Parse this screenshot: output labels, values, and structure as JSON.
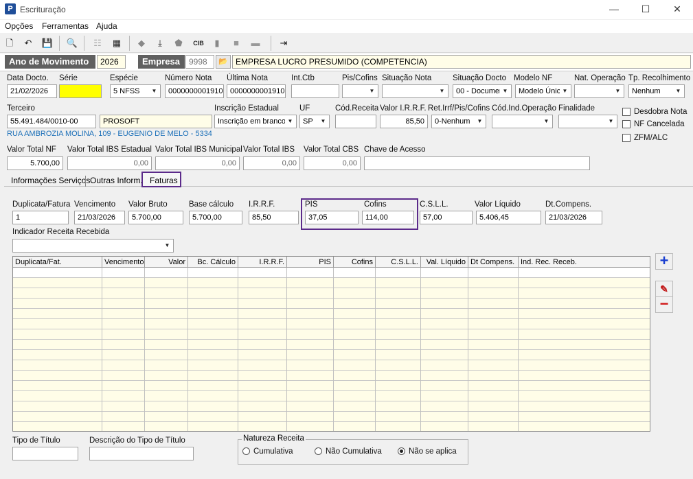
{
  "window": {
    "title": "Escrituração",
    "icon_letter": "P",
    "minimize": "—",
    "maximize": "☐",
    "close": "✕"
  },
  "menu": [
    "Opções",
    "Ferramentas",
    "Ajuda"
  ],
  "header": {
    "ano_label": "Ano de Movimento",
    "ano_value": "2026",
    "empresa_label": "Empresa",
    "empresa_code": "9998",
    "empresa_name": "EMPRESA LUCRO PRESUMIDO (COMPETENCIA)"
  },
  "row1": {
    "data_docto": {
      "label": "Data Docto.",
      "value": "21/02/2026"
    },
    "serie": {
      "label": "Série",
      "value": ""
    },
    "especie": {
      "label": "Espécie",
      "value": "5 NFSS"
    },
    "numero_nota": {
      "label": "Número Nota",
      "value": "0000000001910"
    },
    "ultima_nota": {
      "label": "Última Nota",
      "value": "0000000001910"
    },
    "int_ctb": {
      "label": "Int.Ctb",
      "value": ""
    },
    "pis_cofins": {
      "label": "Pis/Cofins",
      "value": ""
    },
    "situacao_nota": {
      "label": "Situação Nota",
      "value": ""
    },
    "situacao_docto": {
      "label": "Situação Docto",
      "value": "00 - Documer"
    },
    "modelo_nf": {
      "label": "Modelo NF",
      "value": "Modelo Únic"
    },
    "nat_operacao": {
      "label": "Nat. Operação",
      "value": ""
    },
    "tp_recolhimento": {
      "label": "Tp. Recolhimento",
      "value": "Nenhum"
    }
  },
  "row2": {
    "terceiro": {
      "label": "Terceiro",
      "cnpj": "55.491.484/0010-00",
      "name": "PROSOFT"
    },
    "inscricao_estadual": {
      "label": "Inscrição Estadual",
      "value": "Inscrição em branco"
    },
    "uf": {
      "label": "UF",
      "value": "SP"
    },
    "cod_receita": {
      "label": "Cód.Receita",
      "value": ""
    },
    "valor_irrf": {
      "label": "Valor I.R.R.F.",
      "value": "85,50"
    },
    "ret_irrf": {
      "label": "Ret.Irrf/Pis/Cofins",
      "value": "0-Nenhum"
    },
    "cod_ind_operacao": {
      "label": "Cód.Ind.Operação",
      "value": ""
    },
    "finalidade": {
      "label": "Finalidade",
      "value": ""
    },
    "address": "RUA AMBROZIA MOLINA, 109 - EUGENIO DE MELO - 5334"
  },
  "checkboxes": [
    "Desdobra Nota",
    "NF Cancelada",
    "ZFM/ALC"
  ],
  "row3": {
    "valor_total_nf": {
      "label": "Valor Total NF",
      "value": "5.700,00"
    },
    "valor_total_ibs_estadual": {
      "label": "Valor Total IBS Estadual",
      "value": "0,00"
    },
    "valor_total_ibs_municipal": {
      "label": "Valor Total IBS Municipal",
      "value": "0,00"
    },
    "valor_total_ibs": {
      "label": "Valor Total IBS",
      "value": "0,00"
    },
    "valor_total_cbs": {
      "label": "Valor Total CBS",
      "value": "0,00"
    },
    "chave_acesso": {
      "label": "Chave de Acesso",
      "value": ""
    }
  },
  "tabs": [
    "Informações Serviços",
    "Outras Inform.",
    "Faturas"
  ],
  "faturas": {
    "duplicata": {
      "label": "Duplicata/Fatura",
      "value": "1"
    },
    "vencimento": {
      "label": "Vencimento",
      "value": "21/03/2026"
    },
    "valor_bruto": {
      "label": "Valor Bruto",
      "value": "5.700,00"
    },
    "base_calculo": {
      "label": "Base cálculo",
      "value": "5.700,00"
    },
    "irrf": {
      "label": "I.R.R.F.",
      "value": "85,50"
    },
    "pis": {
      "label": "PIS",
      "value": "37,05"
    },
    "cofins": {
      "label": "Cofins",
      "value": "114,00"
    },
    "csll": {
      "label": "C.S.L.L.",
      "value": "57,00"
    },
    "valor_liquido": {
      "label": "Valor Líquido",
      "value": "5.406,45"
    },
    "dt_compens": {
      "label": "Dt.Compens.",
      "value": "21/03/2026"
    },
    "indicador": {
      "label": "Indicador Receita Recebida",
      "value": ""
    }
  },
  "grid_columns": [
    "Duplicata/Fat.",
    "Vencimento",
    "Valor",
    "Bc. Cálculo",
    "I.R.R.F.",
    "PIS",
    "Cofins",
    "C.S.L.L.",
    "Val. Líquido",
    "Dt Compens.",
    "Ind. Rec. Receb."
  ],
  "bottom": {
    "tipo_titulo": {
      "label": "Tipo de Título",
      "value": ""
    },
    "descricao_tipo": {
      "label": "Descrição do Tipo de Título",
      "value": ""
    },
    "natureza": {
      "title": "Natureza Receita",
      "options": [
        "Cumulativa",
        "Não Cumulativa",
        "Não se aplica"
      ],
      "selected": "Não se aplica"
    }
  },
  "colors": {
    "highlight": "#5b2a8a",
    "accent_blue": "#1b6fb8",
    "yellow": "#ffff00"
  }
}
